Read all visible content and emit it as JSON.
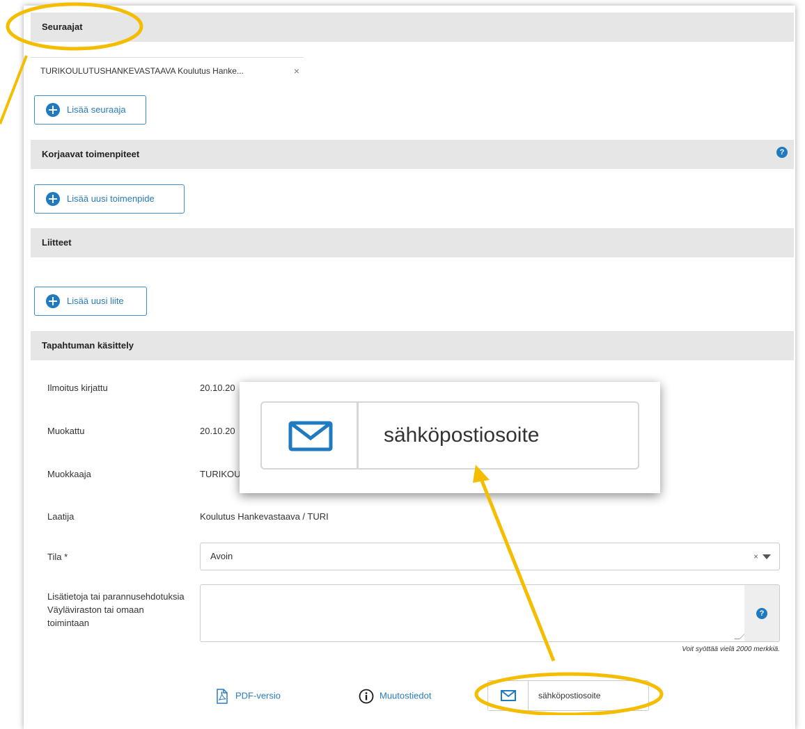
{
  "sections": {
    "followers_title": "Seuraajat",
    "corrective_title": "Korjaavat toimenpiteet",
    "attachments_title": "Liitteet",
    "processing_title": "Tapahtuman käsittely"
  },
  "followers": {
    "tag_label": "TURIKOULUTUSHANKEVASTAAVA Koulutus Hanke...",
    "remove_glyph": "×",
    "add_button": "Lisää seuraaja"
  },
  "corrective": {
    "add_button": "Lisää uusi toimenpide",
    "help_glyph": "?"
  },
  "attachments": {
    "add_button": "Lisää uusi liite"
  },
  "processing": {
    "registered_label": "Ilmoitus kirjattu",
    "registered_value": "20.10.20",
    "modified_label": "Muokattu",
    "modified_value": "20.10.20",
    "modifier_label": "Muokkaaja",
    "modifier_value": "TURIKOU",
    "author_label": "Laatija",
    "author_value": "Koulutus Hankevastaava / TURI",
    "status_label": "Tila *",
    "status_value": "Avoin",
    "status_clear": "×",
    "notes_label": "Lisätietoja tai parannusehdotuksia Väyläviraston tai omaan toimintaan",
    "notes_help": "?",
    "char_count": "Voit syöttää vielä 2000 merkkiä."
  },
  "footer": {
    "pdf_link": "PDF-versio",
    "changes_link": "Muutostiedot",
    "email_placeholder": "sähköpostiosoite"
  },
  "zoom_callout": {
    "email_placeholder": "sähköpostiosoite"
  },
  "colors": {
    "accent": "#1f7ac0",
    "highlight": "#f5bd00",
    "section_bg": "#e6e6e6"
  }
}
